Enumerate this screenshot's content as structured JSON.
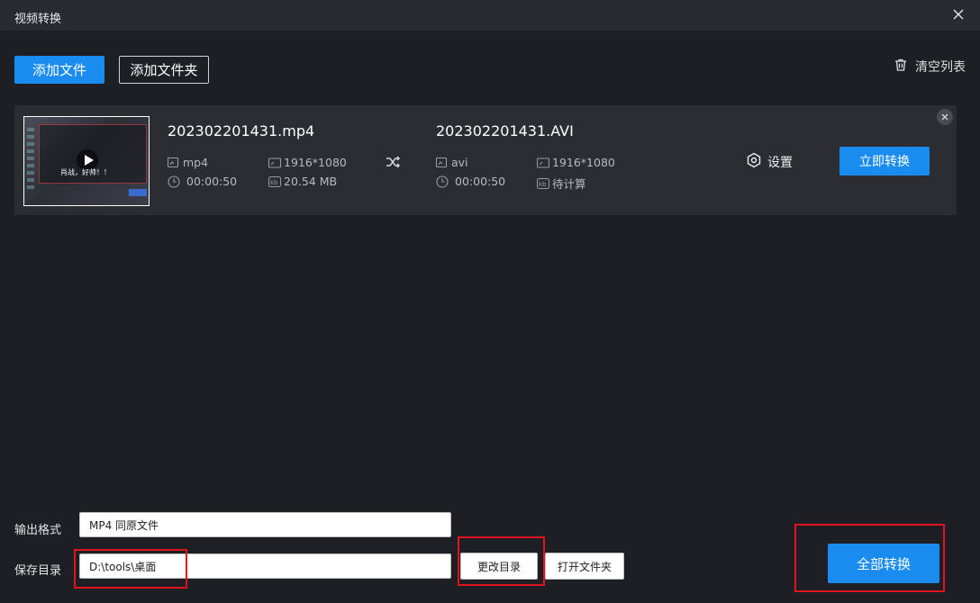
{
  "window": {
    "title": "视频转换"
  },
  "toolbar": {
    "add_file": "添加文件",
    "add_folder": "添加文件夹",
    "clear_list": "清空列表"
  },
  "file": {
    "thumbnail_text": "肖战，好帅！！",
    "source": {
      "name": "202302201431.mp4",
      "format": "mp4",
      "resolution": "1916*1080",
      "duration": "00:00:50",
      "size": "20.54 MB"
    },
    "target": {
      "name": "202302201431.AVI",
      "format": "avi",
      "resolution": "1916*1080",
      "duration": "00:00:50",
      "size": "待计算"
    },
    "settings_label": "设置",
    "convert_now": "立即转换"
  },
  "output": {
    "format_label": "输出格式",
    "format_value": "MP4 同原文件",
    "dir_label": "保存目录",
    "dir_value": "D:\\tools\\桌面",
    "change_dir": "更改目录",
    "open_folder": "打开文件夹"
  },
  "actions": {
    "convert_all": "全部转换"
  },
  "colors": {
    "accent": "#1a8cf0",
    "highlight": "#e0141c",
    "background": "#1e1f24",
    "card": "#2c2d33"
  }
}
